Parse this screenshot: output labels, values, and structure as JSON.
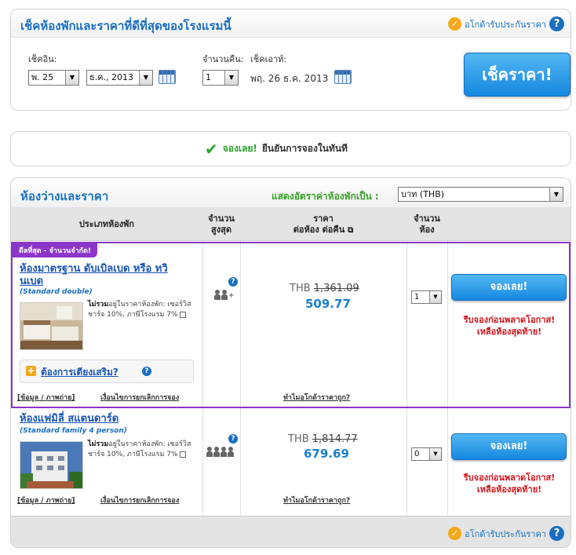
{
  "search": {
    "title": "เช็คห้องพักและราคาที่ดีที่สุดของโรงแรมนี้",
    "guarantee": "อโกด้ารับประกันราคา",
    "checkin_label": "เช็คอิน:",
    "checkin_day": "พ. 25",
    "checkin_month": "ธ.ค., 2013",
    "nights_label": "จำนวนคืน:",
    "nights": "1",
    "checkout_label": "เช็คเอาท์:",
    "checkout_value": "พฤ. 26 ธ.ค. 2013",
    "check_button": "เช็คราคา!"
  },
  "confirm": {
    "book_now": "จองเลย!",
    "text": "ยืนยันการจองในทันที"
  },
  "rooms": {
    "title": "ห้องว่างและราคา",
    "currency_label": "แสดงอัตราค่าห้องพักเป็น :",
    "currency": "บาท (THB)",
    "headers": {
      "type": "ประเภทห้องพัก",
      "occupancy_line1": "จำนวน",
      "occupancy_line2": "สูงสุด",
      "price_line1": "ราคา",
      "price_line2": "ต่อห้อง ต่อคืน",
      "qty_line1": "จำนวน",
      "qty_line2": "ห้อง"
    },
    "items": [
      {
        "ribbon": "ดีลที่สุด - จำนวนจำกัด!",
        "name": "ห้องมาตรฐาน ดับเบิลเบด หรือ ทวินเบด",
        "name_line1": "ห้องมาตรฐาน ดับเบิลเบด หรือ ทวิ",
        "name_line2": "นเบด",
        "subtitle": "(Standard double)",
        "note_bold": "ไม่รวม",
        "note": "อยู่ในราคาห้องพัก: เซอร์วิสชาร์จ 10%, ภาษีโรงแรม 7%",
        "extra_bed": "ต้องการเตียงเสริม?",
        "info_link": "ข้อมูล / ภาพถ่าย",
        "cancel_link": "เงื่อนไขการยกเลิกการจอง",
        "currency": "THB",
        "old_price": "1,361.09",
        "price": "509.77",
        "why_link": "ทำไมอโกด้าราคาถูก?",
        "qty": "1",
        "book_button": "จองเลย!",
        "urgent_line1": "รีบจองก่อนพลาดโอกาส!",
        "urgent_line2": "เหลือห้องสุดท้าย!"
      },
      {
        "name": "ห้องแฟมิลี่ สแตนดาร์ด",
        "subtitle": "(Standard family 4 person)",
        "note_bold": "ไม่รวม",
        "note": "อยู่ในราคาห้องพัก: เซอร์วิสชาร์จ 10%, ภาษีโรงแรม 7%",
        "info_link": "ข้อมูล / ภาพถ่าย",
        "cancel_link": "เงื่อนไขการยกเลิกการจอง",
        "currency": "THB",
        "old_price": "1,814.77",
        "price": "679.69",
        "why_link": "ทำไมอโกด้าราคาถูก?",
        "qty": "0",
        "book_button": "จองเลย!",
        "urgent_line1": "รีบจองก่อนพลาดโอกาส!",
        "urgent_line2": "เหลือห้องสุดท้าย!"
      }
    ],
    "footer_guarantee": "อโกด้ารับประกันราคา"
  }
}
